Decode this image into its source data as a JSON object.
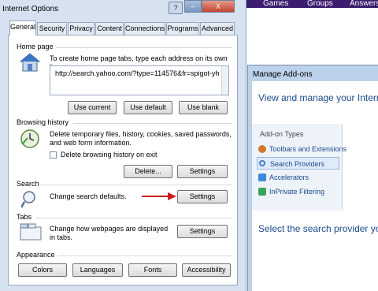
{
  "background": {
    "nav_items": [
      "Games",
      "Groups",
      "Answers"
    ]
  },
  "addons": {
    "title": "Manage Add-ons",
    "heading": "View and manage your Interne",
    "types_title": "Add-on Types",
    "types": [
      {
        "label": "Toolbars and Extensions",
        "icon": "gear-icon",
        "color": "#d4762c"
      },
      {
        "label": "Search Providers",
        "icon": "search-icon",
        "color": "#4a7bc0"
      },
      {
        "label": "Accelerators",
        "icon": "accelerator-icon",
        "color": "#3a8ad8"
      },
      {
        "label": "InPrivate Filtering",
        "icon": "inprivate-icon",
        "color": "#3aa25a"
      }
    ],
    "select_text": "Select the search provider you"
  },
  "dialog": {
    "title": "Internet Options",
    "title_buttons": [
      "?",
      "–",
      "X"
    ],
    "tabs": [
      "General",
      "Security",
      "Privacy",
      "Content",
      "Connections",
      "Programs",
      "Advanced"
    ],
    "home_page": {
      "label": "Home page",
      "description": "To create home page tabs, type each address on its own line.",
      "url": "http://search.yahoo.com/?type=114576&fr=spigot-yh",
      "buttons": [
        "Use current",
        "Use default",
        "Use blank"
      ]
    },
    "browsing_history": {
      "label": "Browsing history",
      "description": "Delete temporary files, history, cookies, saved passwords, and web form information.",
      "checkbox_label": "Delete browsing history on exit",
      "buttons": [
        "Delete...",
        "Settings"
      ]
    },
    "search": {
      "label": "Search",
      "description": "Change search defaults.",
      "button": "Settings"
    },
    "tabs_section": {
      "label": "Tabs",
      "description": "Change how webpages are displayed in tabs.",
      "button": "Settings"
    },
    "appearance": {
      "label": "Appearance",
      "buttons": [
        "Colors",
        "Languages",
        "Fonts",
        "Accessibility"
      ]
    }
  },
  "colors": {
    "annotation_arrow": "#d11a1a",
    "accent_blue": "#1c4a8a"
  }
}
